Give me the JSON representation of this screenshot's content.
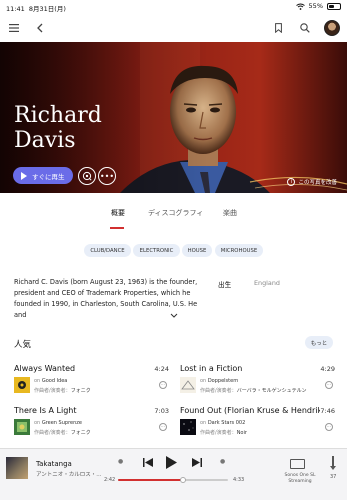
{
  "status": {
    "time": "11:41",
    "date": "8月31日(月)",
    "battery": "55%",
    "battery_level": 0.55
  },
  "nav": {
    "menu_icon": "hamburger-icon",
    "back_icon": "chevron-left-icon",
    "bookmark_icon": "bookmark-icon",
    "search_icon": "search-icon"
  },
  "artist": {
    "name_line1": "Richard",
    "name_line2": "Davis",
    "play_label": "すぐに再生",
    "photo_credit": "この写真を改善"
  },
  "tabs": [
    {
      "label": "概要",
      "active": true
    },
    {
      "label": "ディスコグラフィ",
      "active": false
    },
    {
      "label": "楽曲",
      "active": false
    }
  ],
  "genres": [
    "CLUB/DANCE",
    "ELECTRONIC",
    "HOUSE",
    "MICROHOUSE"
  ],
  "bio": {
    "text": "Richard C. Davis (born August 23, 1963) is the founder, president and CEO of Trademark Properties, which he founded in 1990, in Charleston, South Carolina, U.S. He and",
    "born_label": "出生",
    "born_value": "England"
  },
  "popular": {
    "title": "人気",
    "more_label": "もっと",
    "tracks": [
      {
        "title": "Always Wanted",
        "duration": "4:24",
        "on_label": "on",
        "album": "Good Idea",
        "credit_label": "作曲者/演奏者：",
        "credit": "フォニク"
      },
      {
        "title": "Lost in a Fiction",
        "duration": "4:29",
        "on_label": "on",
        "album": "Doppelstern",
        "credit_label": "作曲者/演奏者：",
        "credit": "バーバラ・モルゲンシュテルン"
      },
      {
        "title": "There Is A Light",
        "duration": "7:03",
        "on_label": "on",
        "album": "Green Suprenze",
        "credit_label": "作曲者/演奏者：",
        "credit": "フォニク"
      },
      {
        "title": "Found Out (Florian Kruse & Hendrik Bu...",
        "duration": "7:46",
        "on_label": "on",
        "album": "Dark Stars 002",
        "credit_label": "作曲者/演奏者：",
        "credit": "Noir"
      }
    ]
  },
  "now_playing": {
    "title": "Takatanga",
    "artist": "アントニオ・カルロス・...",
    "elapsed": "2:42",
    "total": "4:33",
    "progress": 0.59,
    "device_line1": "Sonos One SL",
    "device_line2": "Streaming",
    "volume": "37"
  }
}
